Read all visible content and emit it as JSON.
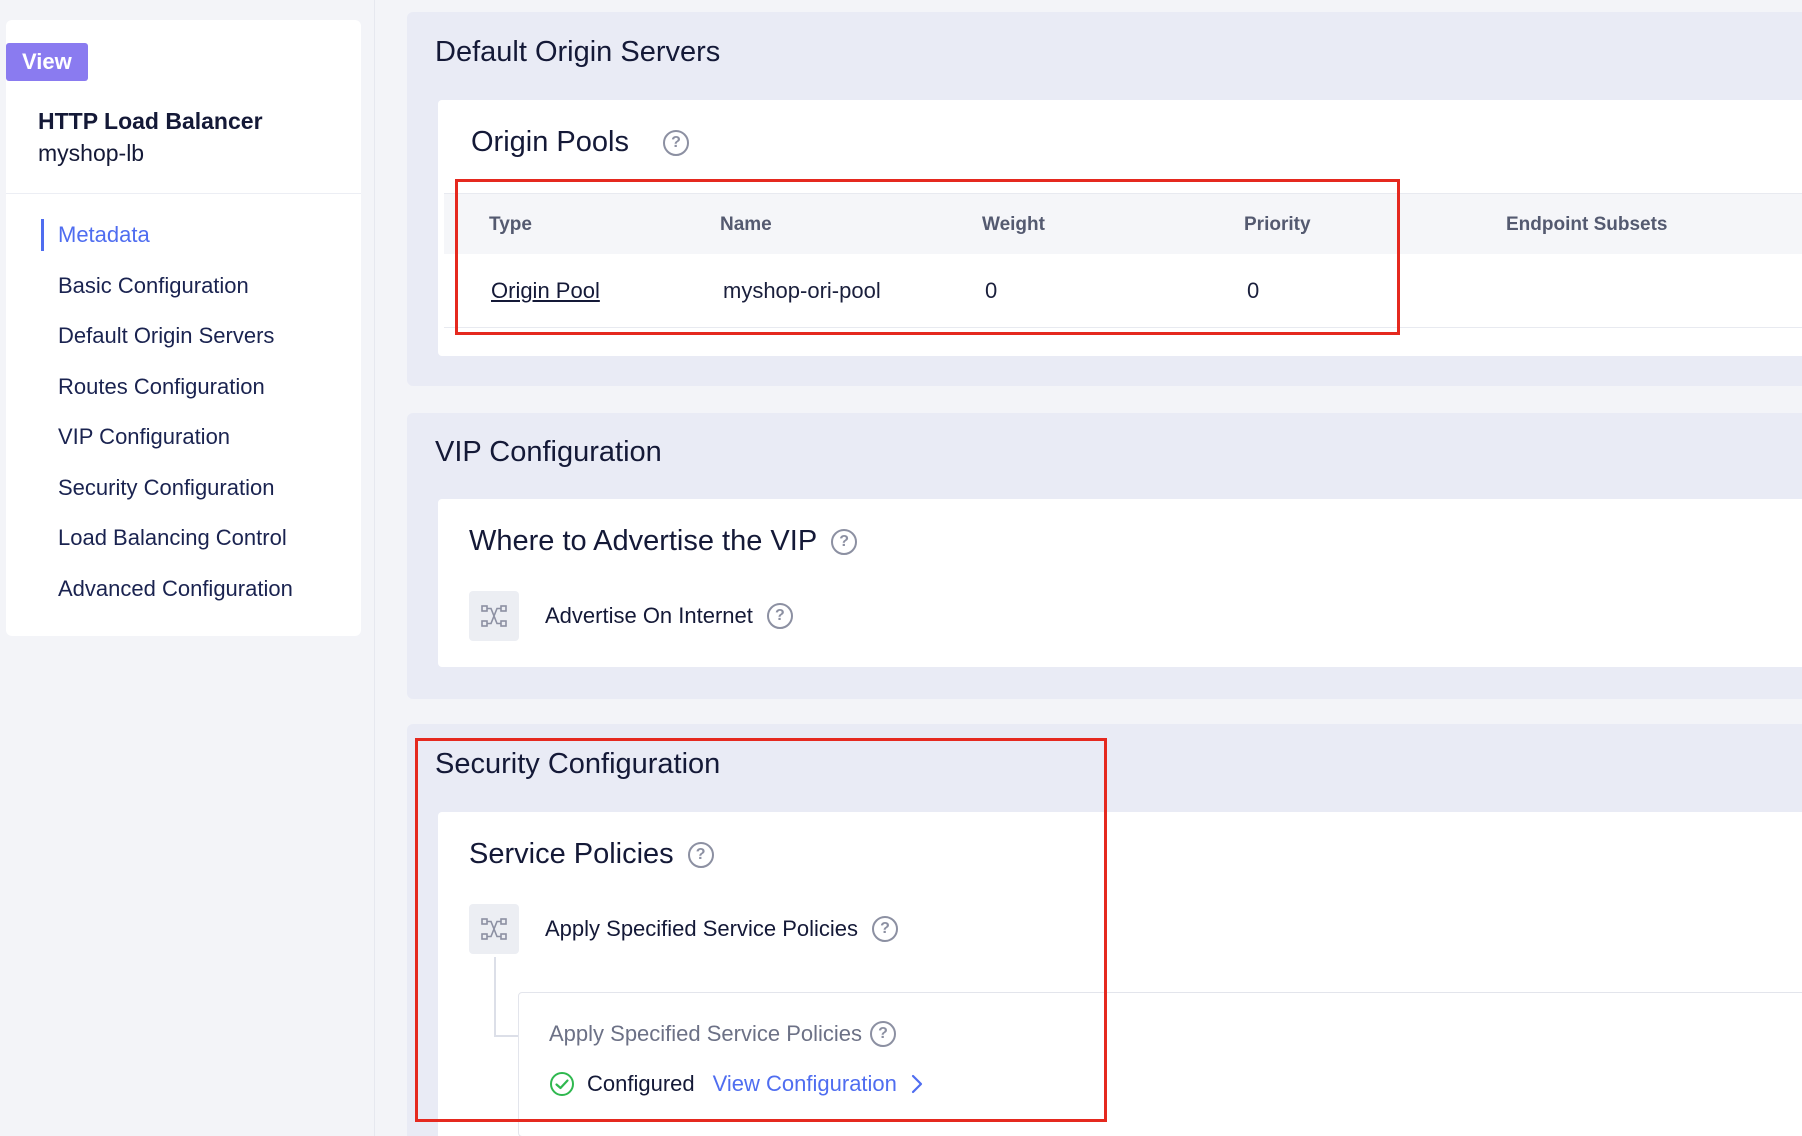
{
  "sidebar": {
    "badge": "View",
    "object_type": "HTTP Load Balancer",
    "object_name": "myshop-lb",
    "items": [
      {
        "label": "Metadata",
        "active": true
      },
      {
        "label": "Basic Configuration",
        "active": false
      },
      {
        "label": "Default Origin Servers",
        "active": false
      },
      {
        "label": "Routes Configuration",
        "active": false
      },
      {
        "label": "VIP Configuration",
        "active": false
      },
      {
        "label": "Security Configuration",
        "active": false
      },
      {
        "label": "Load Balancing Control",
        "active": false
      },
      {
        "label": "Advanced Configuration",
        "active": false
      }
    ]
  },
  "origin": {
    "section_title": "Default Origin Servers",
    "card_title": "Origin Pools",
    "help_icon": "question-circle-icon",
    "columns": [
      "Type",
      "Name",
      "Weight",
      "Priority",
      "Endpoint Subsets"
    ],
    "rows": [
      {
        "type": "Origin Pool",
        "name": "myshop-ori-pool",
        "weight": "0",
        "priority": "0",
        "endpoint_subsets": ""
      }
    ]
  },
  "vip": {
    "section_title": "VIP Configuration",
    "card_title": "Where to Advertise the VIP",
    "option_label": "Advertise On Internet",
    "option_icon": "branch-icon"
  },
  "security": {
    "section_title": "Security Configuration",
    "card_title": "Service Policies",
    "option_label": "Apply Specified Service Policies",
    "option_icon": "branch-icon",
    "sub": {
      "title": "Apply Specified Service Policies",
      "status": "Configured",
      "status_icon": "check-circle-icon",
      "link": "View Configuration",
      "link_icon": "chevron-right-icon"
    }
  },
  "colors": {
    "accent": "#4f6df0",
    "badge": "#8a7bf0",
    "highlight": "#e5291f",
    "success": "#2fb84f"
  }
}
